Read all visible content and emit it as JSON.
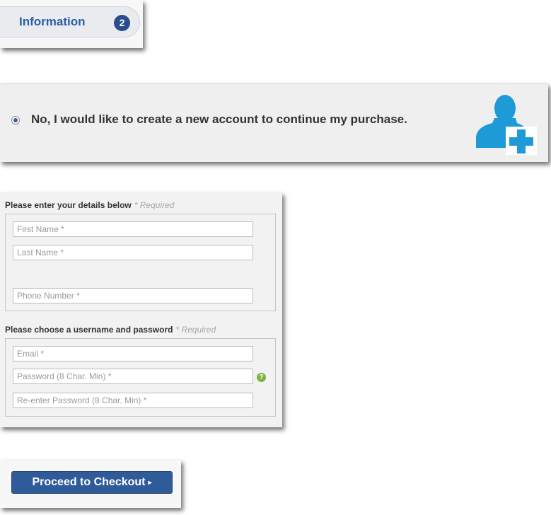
{
  "step_tab": {
    "label": "Information",
    "step_number": "2"
  },
  "account_option": {
    "label": "No, I would like to create a new account to continue my purchase.",
    "selected": true,
    "icon": "user-add-icon",
    "icon_color": "#1e9ad6"
  },
  "details_section": {
    "heading": "Please enter your details below",
    "required_note": "* Required",
    "fields": {
      "first_name": {
        "placeholder": "First Name *",
        "value": ""
      },
      "last_name": {
        "placeholder": "Last Name *",
        "value": ""
      },
      "phone": {
        "placeholder": "Phone Number *",
        "value": ""
      }
    }
  },
  "credentials_section": {
    "heading": "Please choose a username and password",
    "required_note": "* Required",
    "fields": {
      "email": {
        "placeholder": "Email *",
        "value": ""
      },
      "password": {
        "placeholder": "Password (8 Char. Min) *",
        "value": ""
      },
      "password_confirm": {
        "placeholder": "Re-enter Password (8 Char. Min) *",
        "value": ""
      }
    },
    "help_icon": {
      "glyph": "?",
      "color": "#7cb342"
    }
  },
  "checkout": {
    "label": "Proceed to Checkout",
    "caret": "▸",
    "color": "#2f5b99"
  }
}
